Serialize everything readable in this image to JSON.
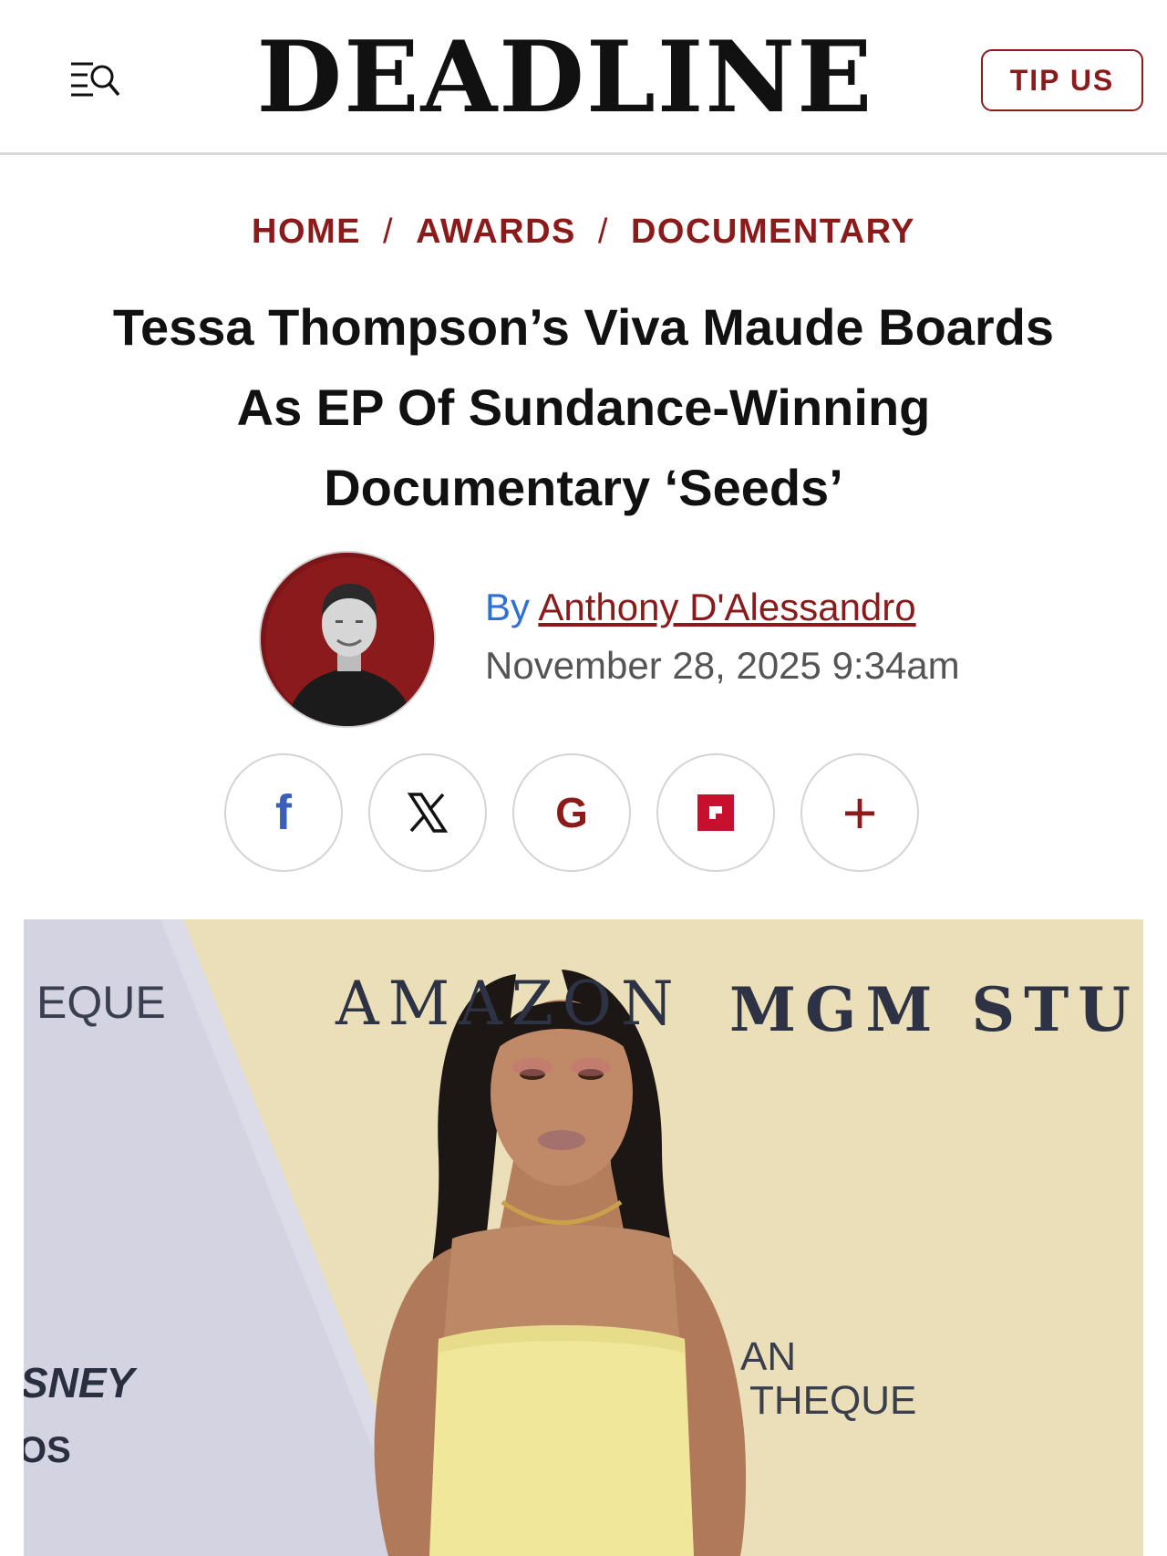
{
  "header": {
    "logo": "DEADLINE",
    "menu_icon": "menu-search-icon",
    "tip_us_label": "TIP US",
    "accent": "#8b1a1a"
  },
  "breadcrumb": {
    "items": [
      "HOME",
      "AWARDS",
      "DOCUMENTARY"
    ],
    "separator": "/"
  },
  "article": {
    "headline_lines": [
      "Tessa Thompson’s Viva Maude Boards",
      "As EP Of Sundance-Winning",
      "Documentary ‘Seeds’"
    ],
    "byline_prefix": "By",
    "author": "Anthony D'Alessandro",
    "date": "November 28, 2025 9:34am"
  },
  "share": {
    "buttons": [
      {
        "name": "facebook",
        "glyph": "f",
        "color": "#3b5fb8",
        "icon": "facebook-icon"
      },
      {
        "name": "x",
        "glyph": "𝕏",
        "color": "#111111",
        "icon": "x-icon"
      },
      {
        "name": "google",
        "glyph": "G",
        "color": "#8b1a1a",
        "icon": "google-icon"
      },
      {
        "name": "flipboard",
        "glyph": "",
        "color": "#c8102e",
        "icon": "flipboard-icon"
      },
      {
        "name": "more",
        "glyph": "+",
        "color": "#8b1a1a",
        "icon": "plus-icon"
      }
    ]
  },
  "hero": {
    "backdrop_text": {
      "left": "EQUE",
      "amazon": "AMAZON",
      "mgm": "MGM STU",
      "disney": "SNEY",
      "os": "OS",
      "an": "AN",
      "theque": "THEQUE"
    }
  }
}
